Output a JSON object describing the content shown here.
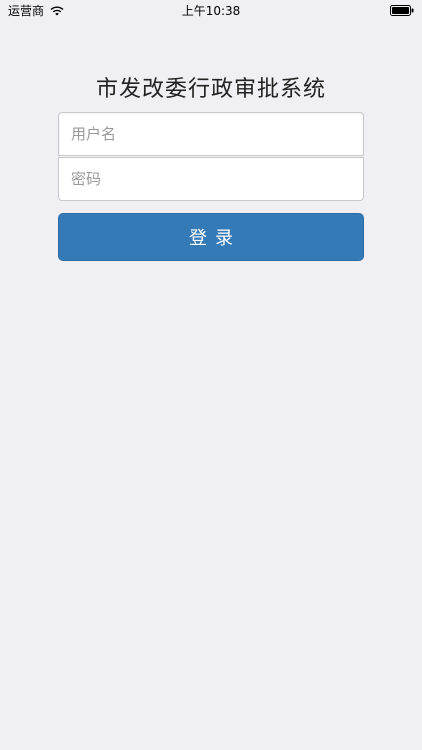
{
  "status_bar": {
    "carrier": "运营商",
    "time": "上午10:38"
  },
  "login": {
    "title": "市发改委行政审批系统",
    "username_placeholder": "用户名",
    "password_placeholder": "密码",
    "submit_label": "登录"
  },
  "colors": {
    "background": "#efeff4",
    "button": "#337ab7"
  },
  "icons": [
    "wifi-icon",
    "battery-icon"
  ]
}
